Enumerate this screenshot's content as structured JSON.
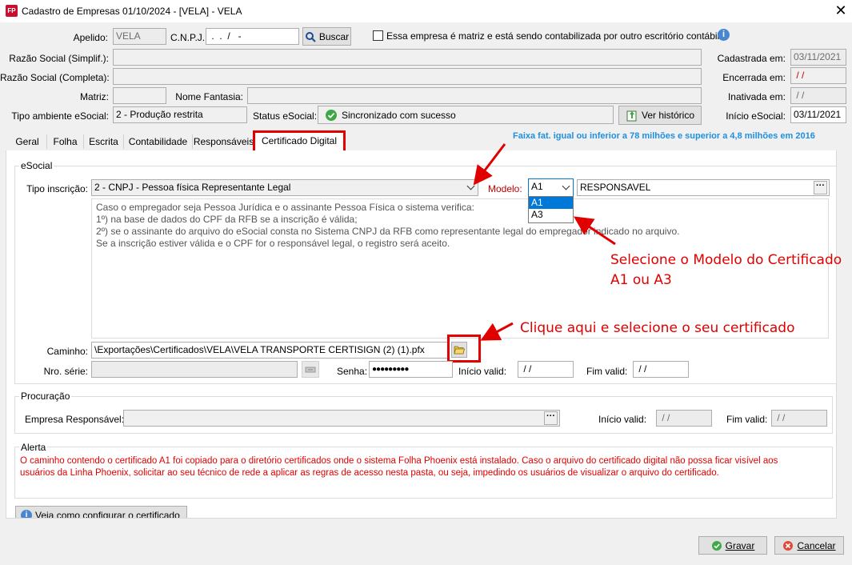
{
  "window": {
    "title": "Cadastro de Empresas  01/10/2024 - [VELA] - VELA",
    "close_glyph": "✕",
    "app_icon_text": "FP"
  },
  "header": {
    "apelido_label": "Apelido:",
    "apelido_value": "VELA",
    "cnpj_label": "C.N.P.J.:",
    "cnpj_value": " .  .  /   -",
    "buscar_label": "Buscar",
    "matriz_check_label": "Essa empresa é matriz e está sendo contabilizada por outro escritório contábil",
    "razao_simpl_label": "Razão Social (Simplif.):",
    "razao_simpl_value": "",
    "razao_comp_label": "Razão Social (Completa):",
    "razao_comp_value": "",
    "matriz_label": "Matriz:",
    "matriz_value": "",
    "nome_fantasia_label": "Nome Fantasia:",
    "nome_fantasia_value": "",
    "tipo_amb_label": "Tipo ambiente eSocial:",
    "tipo_amb_value": "2 - Produção restrita",
    "status_label": "Status eSocial:",
    "status_value": "Sincronizado com sucesso",
    "ver_historico_label": "Ver histórico",
    "cadastrada_label": "Cadastrada em:",
    "cadastrada_value": "03/11/2021",
    "encerrada_label": "Encerrada em:",
    "encerrada_value": " / /",
    "inativada_label": "Inativada em:",
    "inativada_value": " / /",
    "inicio_esocial_label": "Início eSocial:",
    "inicio_esocial_value": "03/11/2021"
  },
  "tabs": [
    {
      "label": "Geral"
    },
    {
      "label": "Folha"
    },
    {
      "label": "Escrita"
    },
    {
      "label": "Contabilidade"
    },
    {
      "label": "Responsáveis"
    },
    {
      "label": "Certificado Digital"
    }
  ],
  "faixa_note": "Faixa fat. igual ou inferior a 78 milhões e superior a 4,8 milhões em 2016",
  "esocial": {
    "group_title": "eSocial",
    "tipo_insc_label": "Tipo inscrição:",
    "tipo_insc_value": "2 - CNPJ - Pessoa física Representante Legal",
    "modelo_label": "Modelo:",
    "modelo_value": "A1",
    "modelo_options": [
      "A1",
      "A3"
    ],
    "responsavel_value": "RESPONSAVEL",
    "info_lines": [
      "Caso o empregador seja Pessoa Jurídica e o assinante Pessoa Física o sistema verifica:",
      "1º) na base de dados do CPF da RFB se a inscrição é válida;",
      "2º) se o assinante do arquivo do eSocial consta no Sistema CNPJ da RFB como representante legal do empregador indicado no arquivo.",
      "Se a inscrição estiver válida e o CPF for o responsável legal, o registro será aceito."
    ],
    "caminho_label": "Caminho:",
    "caminho_value": "\\Exportações\\Certificados\\VELA\\VELA TRANSPORTE CERTISIGN (2) (1).pfx",
    "nro_serie_label": "Nro. série:",
    "nro_serie_value": "",
    "senha_label": "Senha:",
    "senha_value": "●●●●●●●●●",
    "inicio_valid_label": "Início valid:",
    "inicio_valid_value": " / /",
    "fim_valid_label": "Fim valid:",
    "fim_valid_value": " / /"
  },
  "procuracao": {
    "group_title": "Procuração",
    "empresa_resp_label": "Empresa Responsável:",
    "empresa_resp_value": "",
    "inicio_valid_label": "Início valid:",
    "inicio_valid_value": " / /",
    "fim_valid_label": "Fim valid:",
    "fim_valid_value": " / /"
  },
  "alerta": {
    "group_title": "Alerta",
    "line1": "O caminho contendo o certificado A1 foi copiado para o diretório certificados onde o sistema Folha Phoenix está instalado. Caso o arquivo do certificado digital não possa ficar visível aos",
    "line2": "usuários da Linha Phoenix, solicitar ao seu técnico de rede a aplicar as regras de acesso nesta pasta, ou seja, impedindo os usuários de visualizar o arquivo do certificado."
  },
  "veja_button_label": "Veja como configurar o certificado",
  "footer": {
    "gravar_label": "Gravar",
    "cancelar_label": "Cancelar"
  },
  "annotations": {
    "modelo_line1": "Selecione o Modelo do Certificado",
    "modelo_line2": "A1 ou A3",
    "clique": "Clique aqui e selecione o seu certificado"
  },
  "colors": {
    "annotation_red": "#e00000",
    "alert_text": "#e00000",
    "faixa_blue": "#1e90e0",
    "select_highlight": "#0078d7"
  }
}
